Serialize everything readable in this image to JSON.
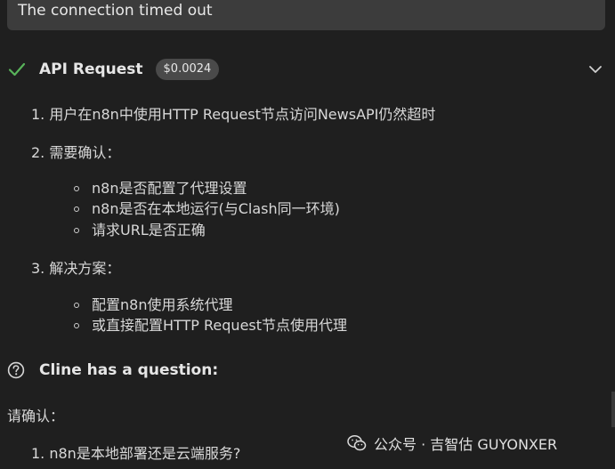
{
  "message": {
    "text": "The connection timed out"
  },
  "api_request": {
    "title": "API Request",
    "cost": "$0.0024"
  },
  "content": {
    "item1": "1. 用户在n8n中使用HTTP Request节点访问NewsAPI仍然超时",
    "item2": "2. 需要确认：",
    "item2_bullets": [
      "n8n是否配置了代理设置",
      "n8n是否在本地运行(与Clash同一环境)",
      "请求URL是否正确"
    ],
    "item3": "3. 解决方案：",
    "item3_bullets": [
      "配置n8n使用系统代理",
      "或直接配置HTTP Request节点使用代理"
    ]
  },
  "question": {
    "title": "Cline has a question:",
    "prompt": "请确认：",
    "items": [
      "1. n8n是本地部署还是云端服务?"
    ]
  },
  "watermark": {
    "text": "公众号 · 吉智估 GUYONXER"
  },
  "colors": {
    "background": "#1f1f1f",
    "message_box": "#3c3c3c",
    "badge": "#4a4a4a",
    "success": "#4caf50"
  }
}
